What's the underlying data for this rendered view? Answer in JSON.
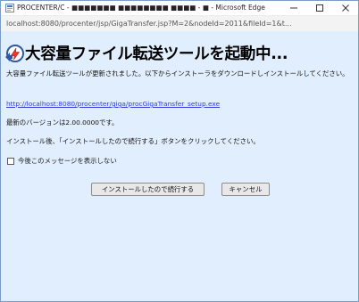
{
  "window": {
    "title": "PROCENTER/C - ■■■■■■■ ■■■■■■■■ ■■■■ - ■ - Microsoft Edge",
    "address": "localhost:8080/procenter/jsp/GigaTransfer.jsp?M=2&nodeId=2011&fileId=1&t..."
  },
  "page": {
    "heading": "大容量ファイル転送ツールを起動中...",
    "intro": "大容量ファイル転送ツールが更新されました。以下からインストーラをダウンロードしインストールしてください。",
    "download_link": "http://localhost:8080/procenter/giga/procGigaTransfer_setup.exe",
    "version_text": "最新のバージョンは2.00.0000です。",
    "instruction": "インストール後、「インストールしたので続行する」ボタンをクリックしてください。",
    "checkbox_label": "今後このメッセージを表示しない",
    "start_button": "インストールしたので続行する",
    "cancel_button": "キャンセル"
  },
  "icons": {
    "app": "edge-app-icon",
    "heading": "transfer-icon"
  },
  "colors": {
    "content_background": "#e1eefd",
    "link": "#2d3fd6",
    "window_border": "#7a9cc8"
  }
}
